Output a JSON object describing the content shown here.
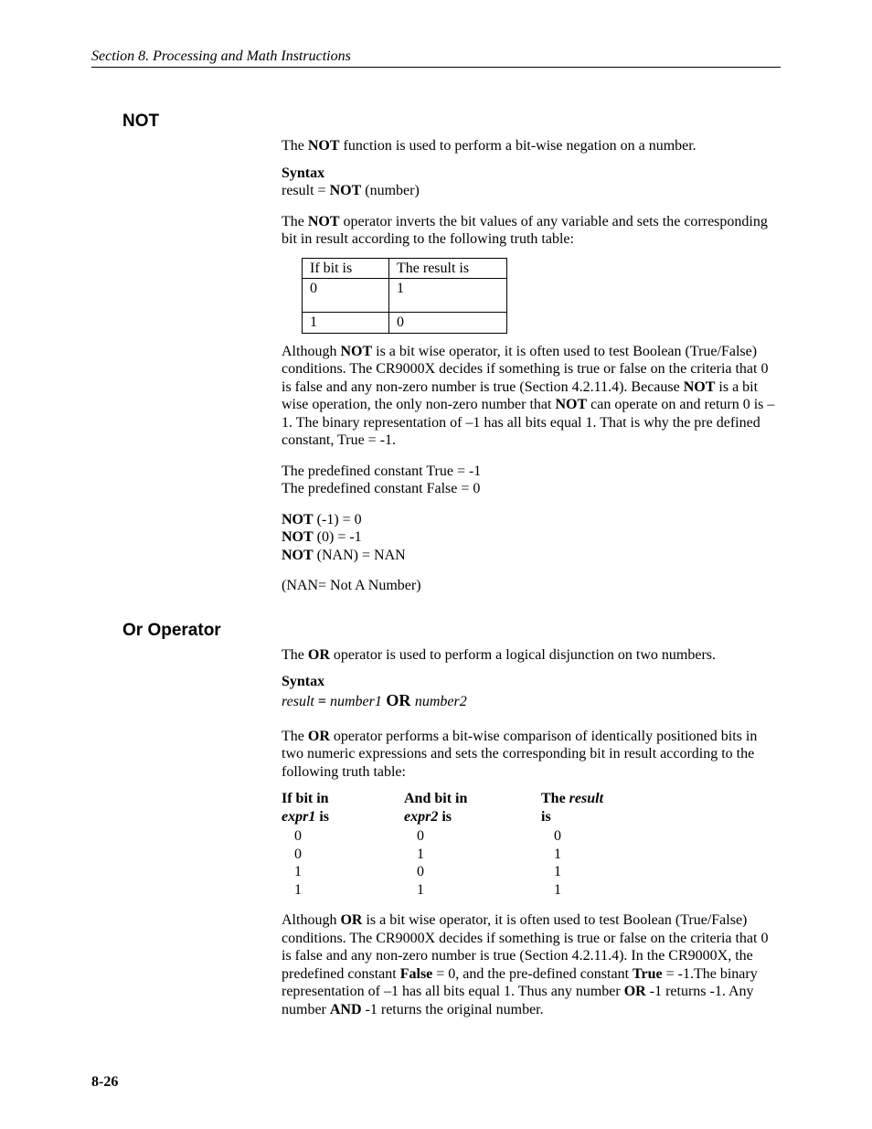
{
  "header": {
    "running": "Section 8.  Processing and Math Instructions"
  },
  "notSection": {
    "heading": "NOT",
    "intro_pre": "The ",
    "intro_bold": "NOT",
    "intro_post": " function is used to perform a bit-wise negation on a number.",
    "syntax_label": "Syntax",
    "syntax_line_pre": "result = ",
    "syntax_line_bold": "NOT",
    "syntax_line_post": " (number)",
    "p2_pre": "The ",
    "p2_bold": "NOT",
    "p2_post": " operator inverts the bit values of any variable and sets the corresponding bit in result according to the following truth table:",
    "tbl": {
      "h1": "If bit is",
      "h2": "The result is",
      "rows": [
        {
          "a": "0",
          "b": "1"
        },
        {
          "a": "1",
          "b": "0"
        }
      ]
    },
    "p3_a": "Although ",
    "p3_b": "NOT",
    "p3_c": " is a bit wise operator, it is often used to test Boolean (True/False) conditions. The CR9000X decides if something is true or false on the criteria that 0 is false and any non-zero number is true (Section 4.2.11.4). Because ",
    "p3_d": "NOT",
    "p3_e": " is a bit wise operation, the only non-zero number that ",
    "p3_f": "NOT",
    "p3_g": " can operate on and return 0 is –1. The binary representation of –1 has all bits equal 1. That is why the pre defined constant, True = -1.",
    "const1": "The predefined constant True = -1",
    "const2": "The predefined constant False = 0",
    "ex1_b": "NOT",
    "ex1_t": " (-1) = 0",
    "ex2_b": "NOT",
    "ex2_t": " (0) = -1",
    "ex3_b": "NOT",
    "ex3_t": " (NAN) = NAN",
    "nan": "(NAN= Not A Number)"
  },
  "orSection": {
    "heading": "Or Operator",
    "intro_pre": "The ",
    "intro_bold": "OR",
    "intro_post": " operator is used to perform a logical disjunction on two numbers.",
    "syntax_label": "Syntax",
    "syn_res": "result",
    "syn_eq": " = ",
    "syn_n1": "number1",
    "syn_or": " OR ",
    "syn_n2": "number2",
    "p2_pre": "The ",
    "p2_bold": "OR",
    "p2_post": " operator performs a bit-wise comparison of identically positioned bits in two numeric expressions and sets the corresponding bit in result according to the following truth table:",
    "tbl": {
      "h1a": "If bit in",
      "h1b_i": "expr1",
      "h1b_t": " is",
      "h2a": "And bit in",
      "h2b_i": "expr2",
      "h2b_t": " is",
      "h3a": "The ",
      "h3a_i": "result",
      "h3b": "is",
      "rows": [
        {
          "a": "0",
          "b": "0",
          "c": "0"
        },
        {
          "a": "0",
          "b": "1",
          "c": "1"
        },
        {
          "a": "1",
          "b": "0",
          "c": "1"
        },
        {
          "a": "1",
          "b": "1",
          "c": "1"
        }
      ]
    },
    "p3_a": "Although ",
    "p3_b": "OR",
    "p3_c": " is a bit wise operator, it is often used to test Boolean (True/False) conditions. The CR9000X decides if something is true or false on the criteria that 0 is false and any non-zero number is true (Section 4.2.11.4).  In the CR9000X, the predefined constant ",
    "p3_d": "False",
    "p3_e": " = 0, and the pre-defined constant ",
    "p3_f": "True",
    "p3_g": " = -1.The binary representation of –1 has all bits equal 1. Thus any number ",
    "p3_h": "OR",
    "p3_i": " -1 returns -1. Any number ",
    "p3_j": "AND",
    "p3_k": " -1 returns the original number."
  },
  "footer": {
    "pageNum": "8-26"
  }
}
